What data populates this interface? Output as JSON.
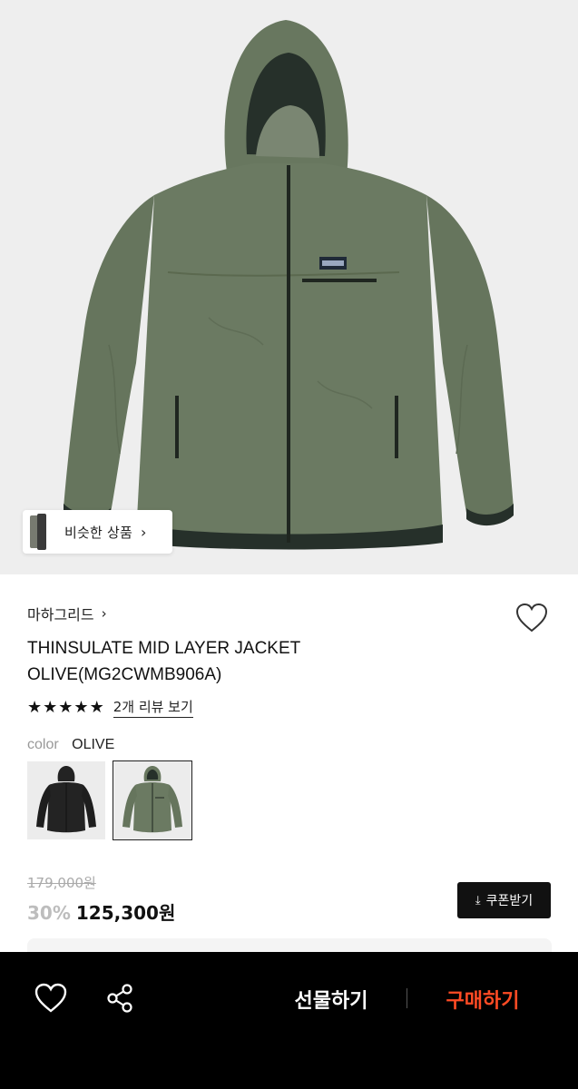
{
  "hero": {
    "similar_label": "비슷한 상품",
    "similar_chevron": "›"
  },
  "product": {
    "brand": "마하그리드",
    "brand_chevron": "›",
    "title_line1": "THINSULATE MID LAYER JACKET",
    "title_line2": "OLIVE(MG2CWMB906A)",
    "stars": [
      "★",
      "★",
      "★",
      "★",
      "★"
    ],
    "rating_value": 5,
    "review_link": "2개 리뷰 보기",
    "color_label": "color",
    "color_value": "OLIVE",
    "swatches": [
      {
        "name": "black",
        "selected": false
      },
      {
        "name": "olive",
        "selected": true
      }
    ],
    "original_price": "179,000원",
    "discount": "30%",
    "price": "125,300원",
    "coupon_icon": "⤓",
    "coupon_label": "쿠폰받기"
  },
  "bottom_bar": {
    "gift_label": "선물하기",
    "buy_label": "구매하기"
  },
  "colors": {
    "jacket_olive": "#6b7a62",
    "jacket_black": "#232323",
    "buy_accent": "#ff4b24",
    "hero_bg": "#eeeeee"
  }
}
